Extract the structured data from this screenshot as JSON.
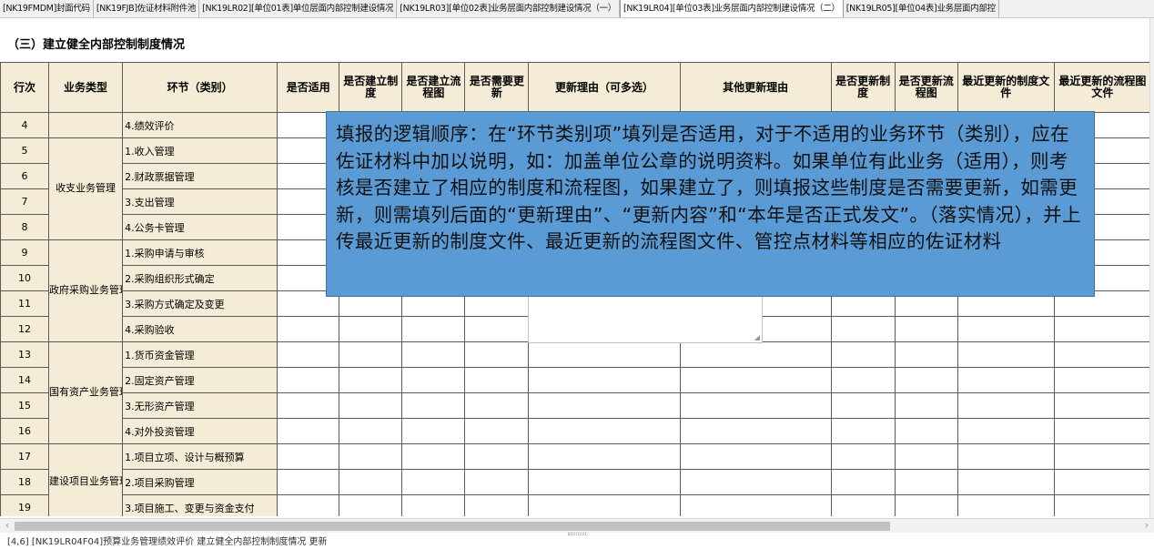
{
  "tabs": [
    {
      "label": "[NK19FMDM]封面代码",
      "active": false
    },
    {
      "label": "[NK19FJB]佐证材料附件池",
      "active": false
    },
    {
      "label": "[NK19LR02][单位01表]单位层面内部控制建设情况",
      "active": false
    },
    {
      "label": "[NK19LR03][单位02表]业务层面内部控制建设情况（一）",
      "active": false
    },
    {
      "label": "[NK19LR04][单位03表]业务层面内部控制建设情况（二）",
      "active": true
    },
    {
      "label": "[NK19LR05][单位04表]业务层面内部控",
      "active": false
    }
  ],
  "section_title": "（三）建立健全内部控制制度情况",
  "headers": [
    "行次",
    "业务类型",
    "环节（类别）",
    "是否适用",
    "是否建立制度",
    "是否建立流程图",
    "是否需要更新",
    "更新理由（可多选）",
    "其他更新理由",
    "是否更新制度",
    "是否更新流程图",
    "最近更新的制度文件",
    "最近更新的流程图文件"
  ],
  "groups": [
    {
      "type": "",
      "rows": [
        {
          "no": "4",
          "stage": "4.绩效评价"
        }
      ]
    },
    {
      "type": "收支业务管理",
      "rows": [
        {
          "no": "5",
          "stage": "1.收入管理"
        },
        {
          "no": "6",
          "stage": "2.财政票据管理"
        },
        {
          "no": "7",
          "stage": "3.支出管理"
        },
        {
          "no": "8",
          "stage": "4.公务卡管理"
        }
      ]
    },
    {
      "type": "政府采购业务管理",
      "rows": [
        {
          "no": "9",
          "stage": "1.采购申请与审核"
        },
        {
          "no": "10",
          "stage": "2.采购组织形式确定"
        },
        {
          "no": "11",
          "stage": "3.采购方式确定及变更"
        },
        {
          "no": "12",
          "stage": "4.采购验收"
        }
      ]
    },
    {
      "type": "国有资产业务管理",
      "rows": [
        {
          "no": "13",
          "stage": "1.货币资金管理"
        },
        {
          "no": "14",
          "stage": "2.固定资产管理"
        },
        {
          "no": "15",
          "stage": "3.无形资产管理"
        },
        {
          "no": "16",
          "stage": "4.对外投资管理"
        }
      ]
    },
    {
      "type": "建设项目业务管理",
      "rows": [
        {
          "no": "17",
          "stage": "1.项目立项、设计与概预算"
        },
        {
          "no": "18",
          "stage": "2.项目采购管理"
        },
        {
          "no": "19",
          "stage": "3.项目施工、变更与资金支付"
        }
      ]
    }
  ],
  "callout": {
    "text": "填报的逻辑顺序：在“环节类别项”填列是否适用，对于不适用的业务环节（类别），应在佐证材料中加以说明，如：加盖单位公章的说明资料。如果单位有此业务（适用），则考核是否建立了相应的制度和流程图，如果建立了，则填报这些制度是否需要更新，如需更新，则需填列后面的“更新理由”、“更新内容”和“本年是否正式发文”。（落实情况），并上传最近更新的制度文件、最近更新的流程图文件、管控点材料等相应的佐证材料"
  },
  "status_bar": "[4,6]  [NK19LR04F04]预算业务管理绩效评价 建立健全内部控制制度情况 更新",
  "colors": {
    "header_bg": "#f4ecd6",
    "callout_bg": "#5b9bd5",
    "grid_line": "#5a5a5a"
  }
}
